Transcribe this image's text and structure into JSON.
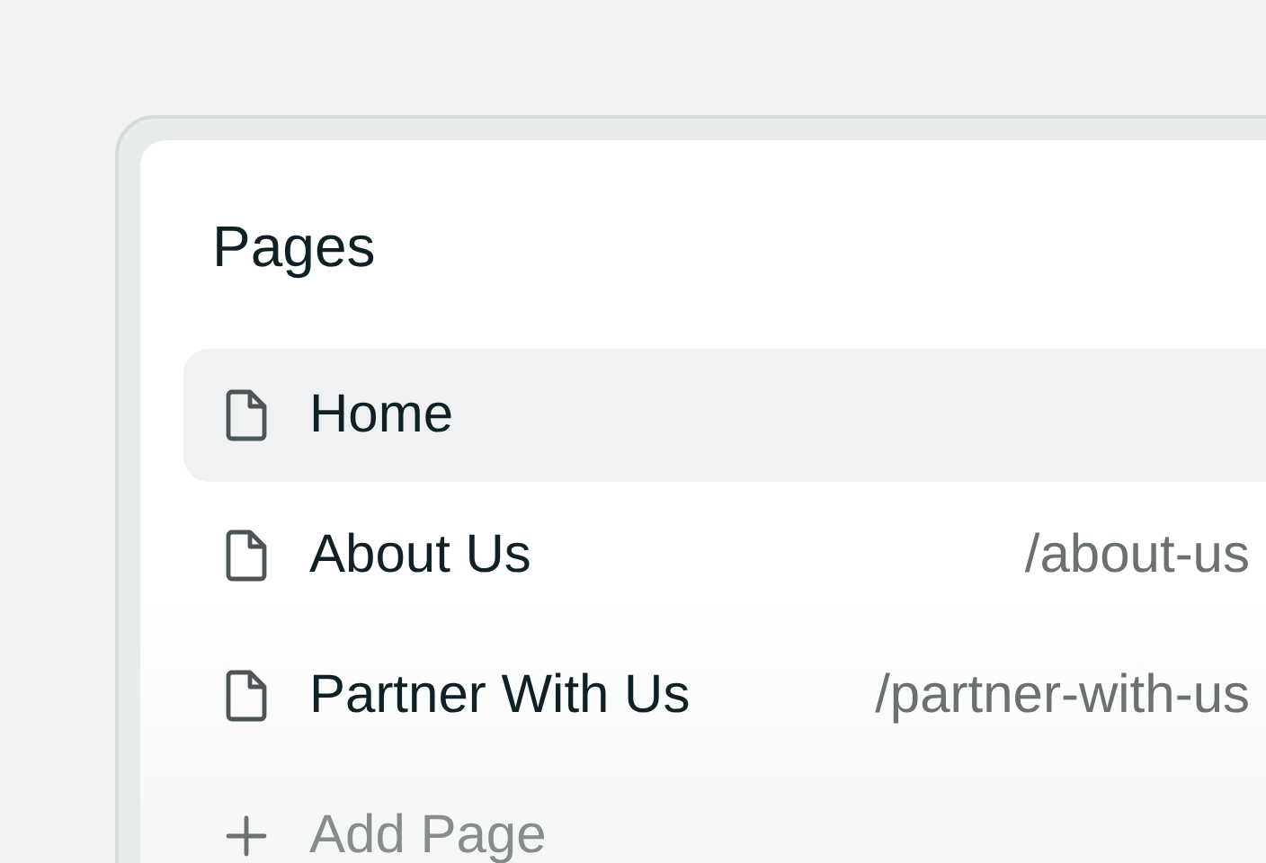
{
  "panel": {
    "title": "Pages"
  },
  "pages": [
    {
      "label": "Home",
      "selected": true
    },
    {
      "label": "About Us",
      "path": "/about-us",
      "selected": false
    },
    {
      "label": "Partner With Us",
      "path": "/partner-with-us",
      "selected": false
    }
  ],
  "add_button": {
    "label": "Add Page"
  }
}
